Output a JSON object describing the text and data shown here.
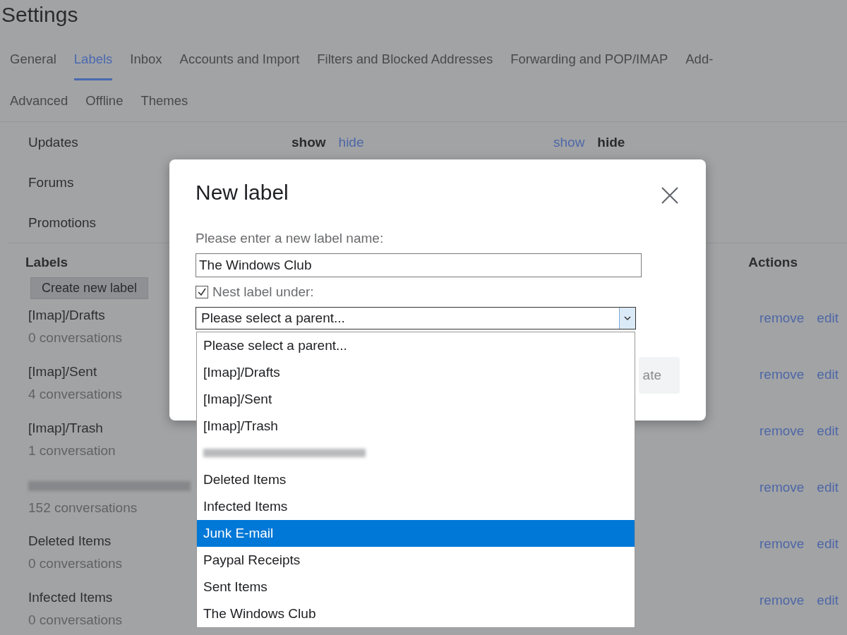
{
  "title": "Settings",
  "tab_rows": [
    {
      "tabs": [
        {
          "label": "General",
          "selected": false
        },
        {
          "label": "Labels",
          "selected": true
        },
        {
          "label": "Inbox",
          "selected": false
        },
        {
          "label": "Accounts and Import",
          "selected": false
        },
        {
          "label": "Filters and Blocked Addresses",
          "selected": false
        },
        {
          "label": "Forwarding and POP/IMAP",
          "selected": false
        },
        {
          "label": "Add-",
          "selected": false
        }
      ]
    },
    {
      "tabs": [
        {
          "label": "Advanced",
          "selected": false
        },
        {
          "label": "Offline",
          "selected": false
        },
        {
          "label": "Themes",
          "selected": false
        }
      ]
    }
  ],
  "categories": [
    {
      "name": "Updates",
      "groups": [
        [
          {
            "label": "show",
            "selected": true
          },
          {
            "label": "hide",
            "selected": false
          }
        ],
        [
          {
            "label": "show",
            "selected": false
          },
          {
            "label": "hide",
            "selected": true
          }
        ]
      ]
    },
    {
      "name": "Forums"
    },
    {
      "name": "Promotions"
    }
  ],
  "labels": {
    "heading": "Labels",
    "actions_heading": "Actions",
    "create_button": "Create new label",
    "rows": [
      {
        "kind": "label",
        "name": "[Imap]/Drafts",
        "count": "0 conversations",
        "actions": [
          "remove",
          "edit"
        ]
      },
      {
        "kind": "label",
        "name": "[Imap]/Sent",
        "count": "4 conversations",
        "actions": [
          "remove",
          "edit"
        ]
      },
      {
        "kind": "label",
        "name": "[Imap]/Trash",
        "count": "1 conversation",
        "actions": [
          "remove",
          "edit"
        ]
      },
      {
        "kind": "blurred",
        "count": "152 conversations",
        "actions": [
          "remove",
          "edit"
        ]
      },
      {
        "kind": "label",
        "name": "Deleted Items",
        "count": "0 conversations",
        "actions": [
          "remove",
          "edit"
        ]
      },
      {
        "kind": "label",
        "name": "Infected Items",
        "count": "0 conversations",
        "actions": [
          "remove",
          "edit"
        ]
      }
    ]
  },
  "dialog": {
    "title": "New label",
    "prompt": "Please enter a new label name:",
    "name_value": "The Windows Club",
    "nest": {
      "label": "Nest label under:",
      "checked": true
    },
    "select_value": "Please select a parent...",
    "options": [
      {
        "kind": "option",
        "label": "Please select a parent...",
        "selected": false
      },
      {
        "kind": "option",
        "label": "[Imap]/Drafts",
        "selected": false
      },
      {
        "kind": "option",
        "label": "[Imap]/Sent",
        "selected": false
      },
      {
        "kind": "option",
        "label": "[Imap]/Trash",
        "selected": false
      },
      {
        "kind": "blurred",
        "selected": false
      },
      {
        "kind": "option",
        "label": "Deleted Items",
        "selected": false
      },
      {
        "kind": "option",
        "label": "Infected Items",
        "selected": false
      },
      {
        "kind": "option",
        "label": "Junk E-mail",
        "selected": true
      },
      {
        "kind": "option",
        "label": "Paypal Receipts",
        "selected": false
      },
      {
        "kind": "option",
        "label": "Sent Items",
        "selected": false
      },
      {
        "kind": "option",
        "label": "The Windows Club",
        "selected": false
      }
    ],
    "create_button": "ate"
  }
}
